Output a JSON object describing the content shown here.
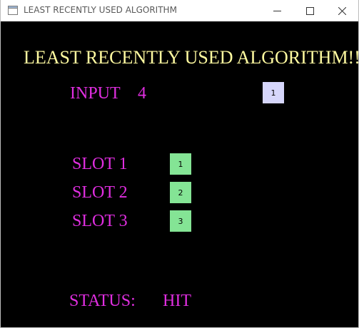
{
  "window": {
    "title": "LEAST RECENTLY USED ALGORITHM",
    "app_icon": "window-icon",
    "buttons": {
      "minimize_icon": "minimize-icon",
      "maximize_icon": "maximize-icon",
      "close_icon": "close-icon"
    }
  },
  "main": {
    "heading": "LEAST RECENTLY USED ALGORITHM!!",
    "input": {
      "label": "INPUT",
      "value": "4",
      "box_value": "1"
    },
    "slots": [
      {
        "label": "SLOT 1",
        "value": "1"
      },
      {
        "label": "SLOT 2",
        "value": "2"
      },
      {
        "label": "SLOT 3",
        "value": "3"
      }
    ],
    "status": {
      "label": "STATUS:",
      "value": "HIT"
    }
  },
  "colors": {
    "background": "#000000",
    "heading": "#fffaa0",
    "label": "#e02ee0",
    "input_box": "#d6d6fb",
    "slot_box": "#84e495"
  }
}
